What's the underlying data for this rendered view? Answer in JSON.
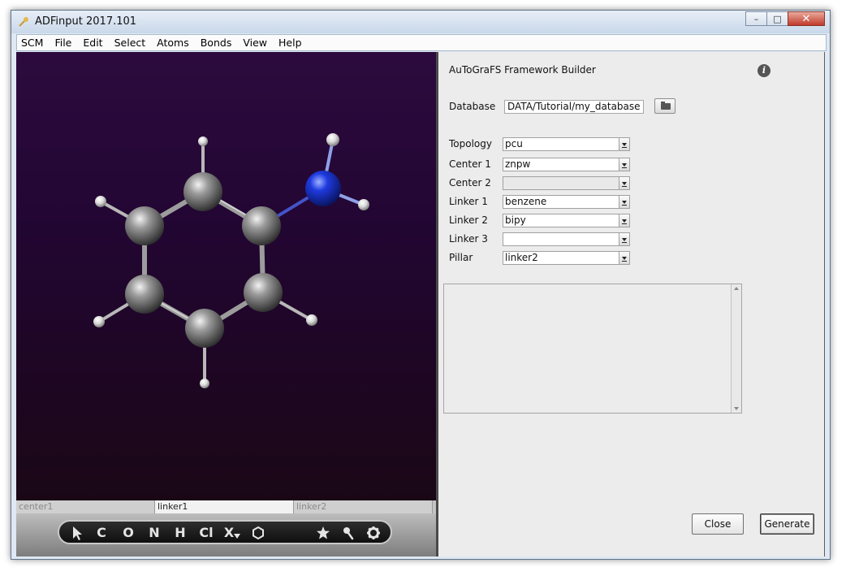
{
  "window": {
    "title": "ADFinput 2017.101",
    "minimize": "–",
    "maximize": "□",
    "close": "✕"
  },
  "menu": [
    "SCM",
    "File",
    "Edit",
    "Select",
    "Atoms",
    "Bonds",
    "View",
    "Help"
  ],
  "viewer": {
    "background_top": "#2c0a3e",
    "background_bottom": "#1a0716",
    "carbon_color": "#8a8a8a",
    "nitrogen_color": "#1e3adf",
    "hydrogen_color": "#ffffff"
  },
  "tabs": [
    {
      "label": "center1",
      "active": false
    },
    {
      "label": "linker1",
      "active": true
    },
    {
      "label": "linker2",
      "active": false
    }
  ],
  "toolbar": {
    "pointer": "select-arrow",
    "carbon": "C",
    "oxygen": "O",
    "nitrogen": "N",
    "hydrogen": "H",
    "chlorine": "Cl",
    "other": "X",
    "ring": "ring-icon",
    "favorites": "star-icon",
    "search": "search-icon",
    "settings": "gear-icon"
  },
  "panel": {
    "title": "AuToGraFS Framework Builder",
    "database_label": "Database",
    "database_value": "DATA/Tutorial/my_database",
    "fields": [
      {
        "label": "Topology",
        "value": "pcu",
        "enabled": true
      },
      {
        "label": "Center 1",
        "value": "znpw",
        "enabled": true
      },
      {
        "label": "Center 2",
        "value": "",
        "enabled": false
      },
      {
        "label": "Linker 1",
        "value": "benzene",
        "enabled": true
      },
      {
        "label": "Linker 2",
        "value": "bipy",
        "enabled": true
      },
      {
        "label": "Linker 3",
        "value": "",
        "enabled": true
      },
      {
        "label": "Pillar",
        "value": "linker2",
        "enabled": true
      }
    ],
    "close_label": "Close",
    "generate_label": "Generate"
  }
}
